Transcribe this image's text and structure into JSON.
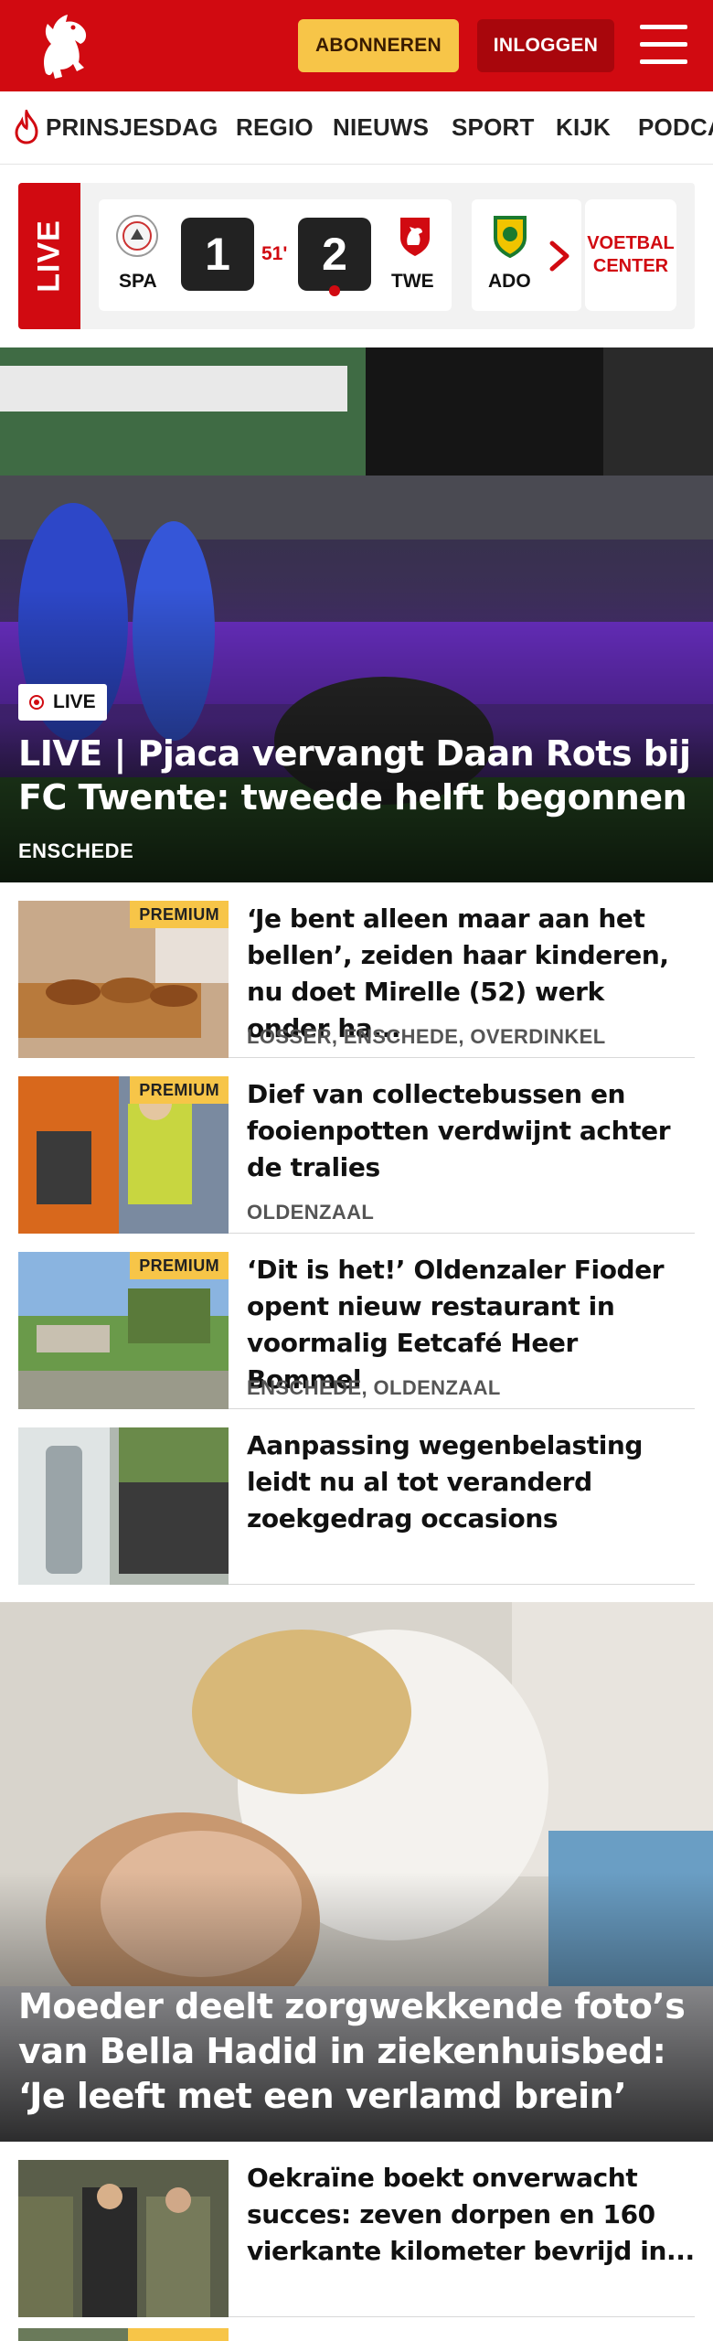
{
  "header": {
    "subscribe_label": "ABONNEREN",
    "login_label": "INLOGGEN",
    "brand_color": "#d10a11"
  },
  "nav": {
    "items": [
      {
        "label": "PRINSJESDAG",
        "icon": "flame-icon"
      },
      {
        "label": "REGIO"
      },
      {
        "label": "NIEUWS"
      },
      {
        "label": "SPORT"
      },
      {
        "label": "KIJK"
      },
      {
        "label": "PODCA"
      }
    ]
  },
  "live": {
    "tag": "LIVE",
    "match": {
      "home_code": "SPA",
      "away_code": "TWE",
      "home_score": "1",
      "away_score": "2",
      "minute": "51'"
    },
    "next_match_code": "ADO",
    "voetbal_center_label": "VOETBAL CENTER"
  },
  "hero": {
    "badge": "LIVE",
    "title": "LIVE | Pjaca vervangt Daan Rots bij FC Twente: tweede helft begonnen",
    "location": "ENSCHEDE"
  },
  "articles": [
    {
      "premium": "PREMIUM",
      "title": "‘Je bent alleen maar aan het bellen’, zeiden haar kinderen, nu doet Mirelle (52) werk onder ha...",
      "location": "LOSSER, ENSCHEDE, OVERDINKEL"
    },
    {
      "premium": "PREMIUM",
      "title": "Dief van collectebussen en fooienpotten verdwijnt achter de tralies",
      "location": "OLDENZAAL"
    },
    {
      "premium": "PREMIUM",
      "title": "‘Dit is het!’ Oldenzaler Fioder opent nieuw restaurant in voormalig Eetcafé Heer Bommel",
      "location": "ENSCHEDE, OLDENZAAL"
    },
    {
      "premium": "",
      "title": "Aanpassing wegenbelasting leidt nu al tot veranderd zoekgedrag occasions",
      "location": ""
    }
  ],
  "big_story": {
    "title": "Moeder deelt zorgwekkende foto’s van Bella Hadid in ziekenhuisbed: ‘Je leeft met een verlamd brein’"
  },
  "articles2": [
    {
      "premium": "",
      "title": "Oekraïne boekt onverwacht succes: zeven dorpen en 160 vierkante kilometer bevrijd in...",
      "location": ""
    }
  ]
}
